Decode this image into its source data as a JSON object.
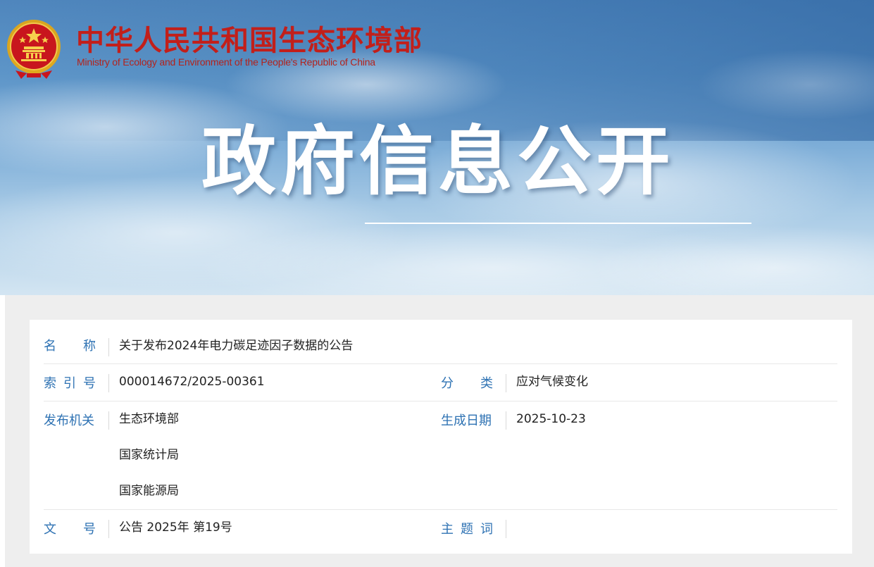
{
  "header": {
    "site_name_cn": "中华人民共和国生态环境部",
    "site_name_en": "Ministry of Ecology and Environment of the People's Republic of China",
    "emblem_icon": "national-emblem-icon",
    "banner_title": "政府信息公开"
  },
  "colors": {
    "accent_red": "#c21f1a",
    "label_blue": "#2e72b3",
    "sky_blue": "#5d95c8"
  },
  "info": {
    "name": {
      "label": [
        "名",
        "称"
      ],
      "value": "关于发布2024年电力碳足迹因子数据的公告"
    },
    "index_no": {
      "label": [
        "索",
        "引",
        "号"
      ],
      "value": "000014672/2025-00361"
    },
    "category": {
      "label": [
        "分",
        "类"
      ],
      "value": "应对气候变化"
    },
    "publisher": {
      "label": "发布机关",
      "values": [
        "生态环境部",
        "国家统计局",
        "国家能源局"
      ]
    },
    "date": {
      "label": "生成日期",
      "value": "2025-10-23"
    },
    "doc_no": {
      "label": [
        "文",
        "号"
      ],
      "value": "公告 2025年 第19号"
    },
    "keywords": {
      "label": [
        "主",
        "题",
        "词"
      ],
      "value": ""
    }
  }
}
